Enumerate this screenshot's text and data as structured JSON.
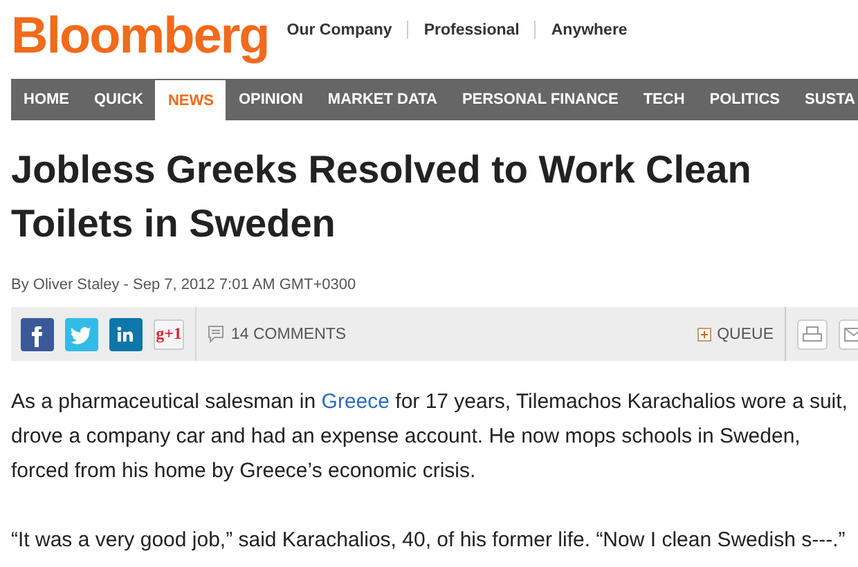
{
  "header": {
    "logo": "Bloomberg",
    "links": [
      "Our Company",
      "Professional",
      "Anywhere"
    ]
  },
  "nav": [
    {
      "label": "HOME",
      "selected": false
    },
    {
      "label": "QUICK",
      "selected": false
    },
    {
      "label": "NEWS",
      "selected": true
    },
    {
      "label": "OPINION",
      "selected": false
    },
    {
      "label": "MARKET DATA",
      "selected": false
    },
    {
      "label": "PERSONAL FINANCE",
      "selected": false
    },
    {
      "label": "TECH",
      "selected": false
    },
    {
      "label": "POLITICS",
      "selected": false
    },
    {
      "label": "SUSTA",
      "selected": false
    }
  ],
  "article": {
    "headline": "Jobless Greeks Resolved to Work Clean Toilets in Sweden",
    "byline": "By Oliver Staley - Sep 7, 2012 7:01 AM GMT+0300",
    "share": [
      {
        "kind": "facebook"
      },
      {
        "kind": "twitter"
      },
      {
        "kind": "linkedin"
      },
      {
        "kind": "gplus",
        "label": "g+1"
      }
    ],
    "comments": "14 COMMENTS",
    "queue": "QUEUE",
    "tools": [
      {
        "kind": "print"
      },
      {
        "kind": "email"
      }
    ],
    "paragraphs": [
      {
        "parts": [
          {
            "kind": "text",
            "text": "As a pharmaceutical salesman in "
          },
          {
            "kind": "link",
            "text": "Greece"
          },
          {
            "kind": "text",
            "text": " for 17 years, Tilemachos Karachalios wore a suit, drove a company car and had an expense account. He now mops schools in Sweden, forced from his home by Greece’s economic crisis."
          }
        ]
      },
      {
        "parts": [
          {
            "kind": "text",
            "text": "“It was a very good job,” said Karachalios, 40, of his former life. “Now I clean Swedish s---.”"
          }
        ]
      }
    ]
  }
}
